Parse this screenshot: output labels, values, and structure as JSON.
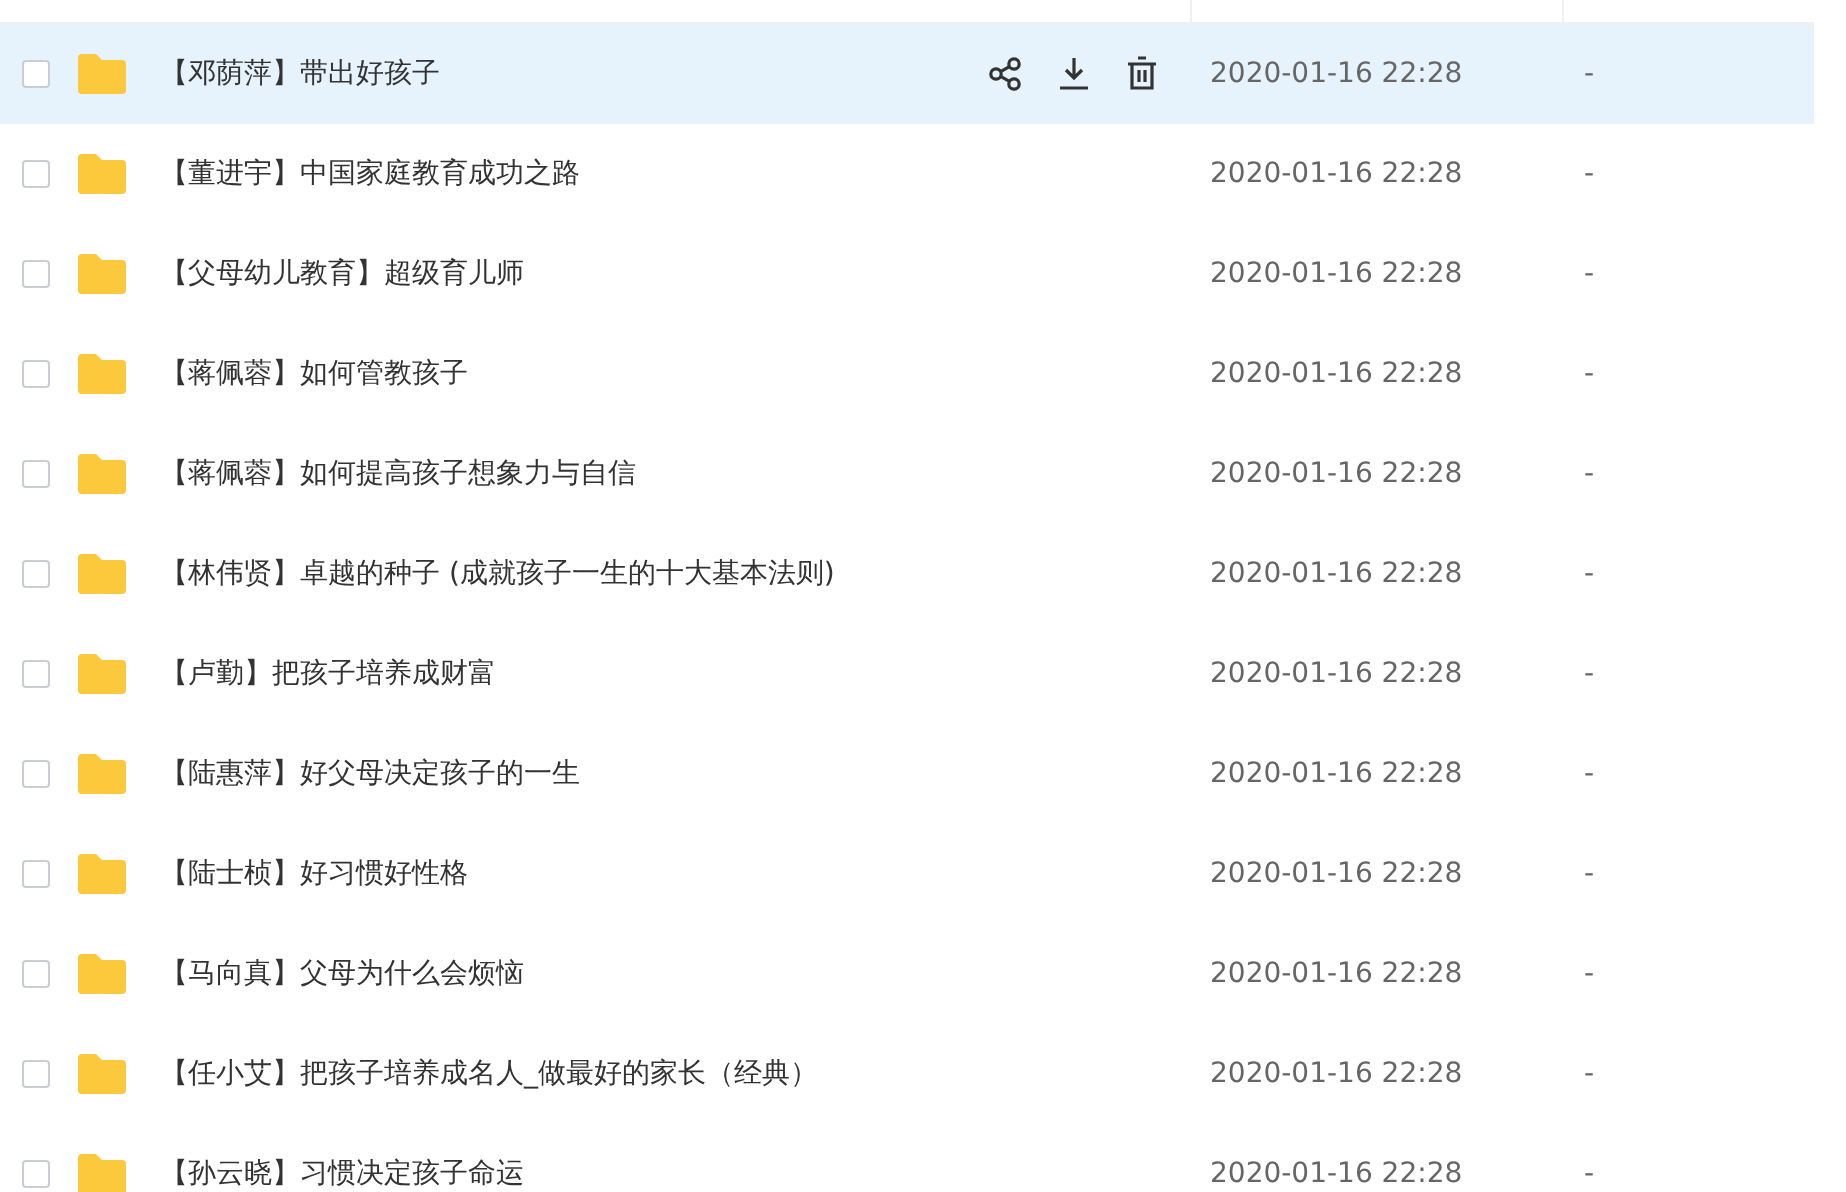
{
  "rows": [
    {
      "name": "【邓荫萍】带出好孩子",
      "modified": "2020-01-16 22:28",
      "size": "-",
      "selected": true
    },
    {
      "name": "【董进宇】中国家庭教育成功之路",
      "modified": "2020-01-16 22:28",
      "size": "-",
      "selected": false
    },
    {
      "name": "【父母幼儿教育】超级育儿师",
      "modified": "2020-01-16 22:28",
      "size": "-",
      "selected": false
    },
    {
      "name": "【蒋佩蓉】如何管教孩子",
      "modified": "2020-01-16 22:28",
      "size": "-",
      "selected": false
    },
    {
      "name": "【蒋佩蓉】如何提高孩子想象力与自信",
      "modified": "2020-01-16 22:28",
      "size": "-",
      "selected": false
    },
    {
      "name": "【林伟贤】卓越的种子 (成就孩子一生的十大基本法则)",
      "modified": "2020-01-16 22:28",
      "size": "-",
      "selected": false
    },
    {
      "name": "【卢勤】把孩子培养成财富",
      "modified": "2020-01-16 22:28",
      "size": "-",
      "selected": false
    },
    {
      "name": "【陆惠萍】好父母决定孩子的一生",
      "modified": "2020-01-16 22:28",
      "size": "-",
      "selected": false
    },
    {
      "name": "【陆士桢】好习惯好性格",
      "modified": "2020-01-16 22:28",
      "size": "-",
      "selected": false
    },
    {
      "name": "【马向真】父母为什么会烦恼",
      "modified": "2020-01-16 22:28",
      "size": "-",
      "selected": false
    },
    {
      "name": "【任小艾】把孩子培养成名人_做最好的家长（经典）",
      "modified": "2020-01-16 22:28",
      "size": "-",
      "selected": false
    },
    {
      "name": "【孙云晓】习惯决定孩子命运",
      "modified": "2020-01-16 22:28",
      "size": "-",
      "selected": false
    }
  ]
}
